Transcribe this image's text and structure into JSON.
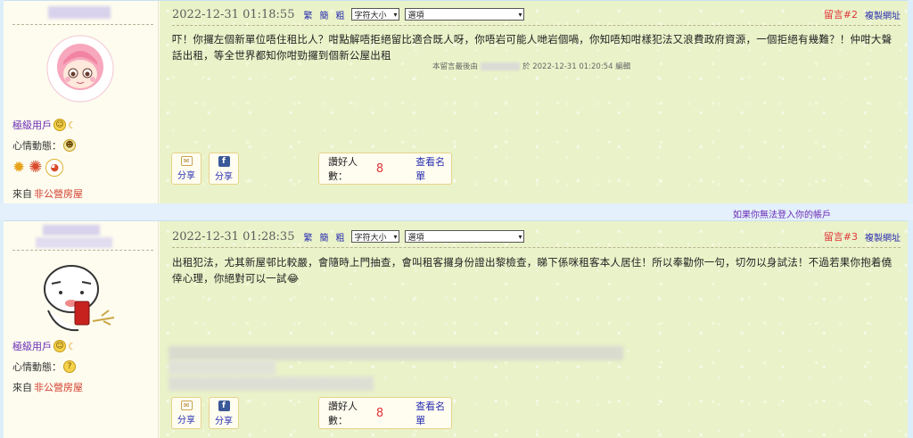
{
  "posts": [
    {
      "timestamp": "2022-12-31 01:18:55",
      "trad_label": "繁",
      "simp_label": "簡",
      "coarse_label": "粗",
      "font_size_select": "字符大小",
      "options_select": "選項",
      "post_number": "留言#2",
      "copy_link": "複製網址",
      "user_level": "極級用戶",
      "mood_label": "心情動態：",
      "from_prefix": "來自",
      "from_place": "非公營房屋",
      "content": "吓！你攞左個新單位唔住租比人？咁點解唔拒絕留比適合既人呀，你唔岩可能人哋岩個喎，你知唔知咁樣犯法又浪費政府資源，一個拒絕有幾難？！仲咁大聲話出租，等全世界都知你咁勁攞到個新公屋出租",
      "edit_prefix": "本留言最後由",
      "edit_suffix": "於 2022-12-31 01:20:54 編輯",
      "share_email": "分享",
      "share_fb": "分享",
      "likes_label": "讚好人數：",
      "likes_count": "8",
      "view_list": "查看名單"
    },
    {
      "timestamp": "2022-12-31 01:28:35",
      "trad_label": "繁",
      "simp_label": "簡",
      "coarse_label": "粗",
      "font_size_select": "字符大小",
      "options_select": "選項",
      "post_number": "留言#3",
      "copy_link": "複製網址",
      "user_level": "極級用戶",
      "mood_label": "心情動態：",
      "from_prefix": "來自",
      "from_place": "非公營房屋",
      "content": "出租犯法，尤其新屋邨比較嚴，會隨時上門抽查，會叫租客攞身份證出黎檢查，睇下係咪租客本人居住！所以奉勸你一句，切勿以身試法！不過若果你抱着僥倖心理，你絕對可以一試😂",
      "share_email": "分享",
      "share_fb": "分享",
      "likes_label": "讚好人數：",
      "likes_count": "8",
      "view_list": "查看名單"
    }
  ],
  "login_link": "如果你無法登入你的帳戶",
  "icons": {
    "emoji_grin": "grin-emoji-icon",
    "mood_face": "mood-face-icon",
    "mood_question": "question-mood-icon",
    "email": "email-icon",
    "facebook": "facebook-icon"
  }
}
